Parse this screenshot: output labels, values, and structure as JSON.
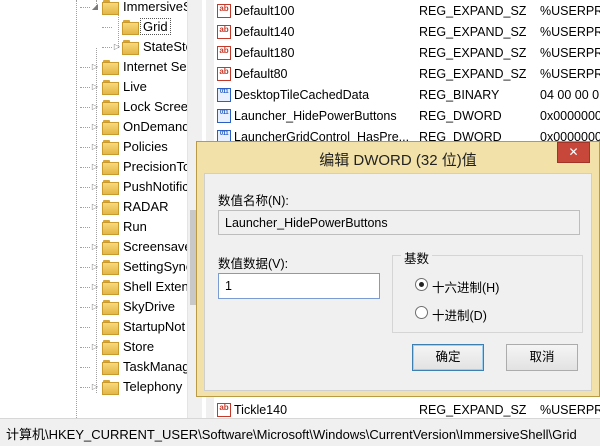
{
  "tree": {
    "items": [
      {
        "label": "ImmersiveS",
        "expander": "◢",
        "depth": 1
      },
      {
        "label": "Grid",
        "expander": "",
        "depth": 2,
        "selected": true
      },
      {
        "label": "StateSto",
        "expander": "▷",
        "depth": 2
      },
      {
        "label": "Internet Se",
        "expander": "▷",
        "depth": 1
      },
      {
        "label": "Live",
        "expander": "▷",
        "depth": 1
      },
      {
        "label": "Lock Scree",
        "expander": "▷",
        "depth": 1
      },
      {
        "label": "OnDemand",
        "expander": "▷",
        "depth": 1
      },
      {
        "label": "Policies",
        "expander": "▷",
        "depth": 1
      },
      {
        "label": "PrecisionTo",
        "expander": "▷",
        "depth": 1
      },
      {
        "label": "PushNotific",
        "expander": "▷",
        "depth": 1
      },
      {
        "label": "RADAR",
        "expander": "▷",
        "depth": 1
      },
      {
        "label": "Run",
        "expander": "",
        "depth": 1
      },
      {
        "label": "Screensave",
        "expander": "▷",
        "depth": 1
      },
      {
        "label": "SettingSync",
        "expander": "▷",
        "depth": 1
      },
      {
        "label": "Shell Extens",
        "expander": "▷",
        "depth": 1
      },
      {
        "label": "SkyDrive",
        "expander": "▷",
        "depth": 1
      },
      {
        "label": "StartupNot",
        "expander": "",
        "depth": 1
      },
      {
        "label": "Store",
        "expander": "▷",
        "depth": 1
      },
      {
        "label": "TaskManag",
        "expander": "",
        "depth": 1
      },
      {
        "label": "Telephony",
        "expander": "▷",
        "depth": 1
      }
    ]
  },
  "values": {
    "rows": [
      {
        "name": "Default100",
        "type": "REG_EXPAND_SZ",
        "data": "%USERPRO",
        "icon": "ab"
      },
      {
        "name": "Default140",
        "type": "REG_EXPAND_SZ",
        "data": "%USERPRO",
        "icon": "ab"
      },
      {
        "name": "Default180",
        "type": "REG_EXPAND_SZ",
        "data": "%USERPRO",
        "icon": "ab"
      },
      {
        "name": "Default80",
        "type": "REG_EXPAND_SZ",
        "data": "%USERPRO",
        "icon": "ab"
      },
      {
        "name": "DesktopTileCachedData",
        "type": "REG_BINARY",
        "data": "04 00 00 0",
        "icon": "bin"
      },
      {
        "name": "Launcher_HidePowerButtons",
        "type": "REG_DWORD",
        "data": "0x0000000",
        "icon": "bin"
      },
      {
        "name": "LauncherGridControl_HasPre...",
        "type": "REG_DWORD",
        "data": "0x0000000",
        "icon": "bin"
      }
    ],
    "bottom_row": {
      "name": "Tickle140",
      "type": "REG_EXPAND_SZ",
      "data": "%USERPRO",
      "icon": "ab"
    }
  },
  "statusbar": {
    "path": "计算机\\HKEY_CURRENT_USER\\Software\\Microsoft\\Windows\\CurrentVersion\\ImmersiveShell\\Grid"
  },
  "dialog": {
    "title": "编辑 DWORD (32 位)值",
    "close_glyph": "✕",
    "name_label": "数值名称(N):",
    "name_value": "Launcher_HidePowerButtons",
    "data_label": "数值数据(V):",
    "data_value": "1",
    "base_label": "基数",
    "hex_label": "十六进制(H)",
    "dec_label": "十进制(D)",
    "selected_base": "hex",
    "ok_label": "确定",
    "cancel_label": "取消",
    "accent_color": "#f2e1a8",
    "close_color": "#c7473a"
  }
}
